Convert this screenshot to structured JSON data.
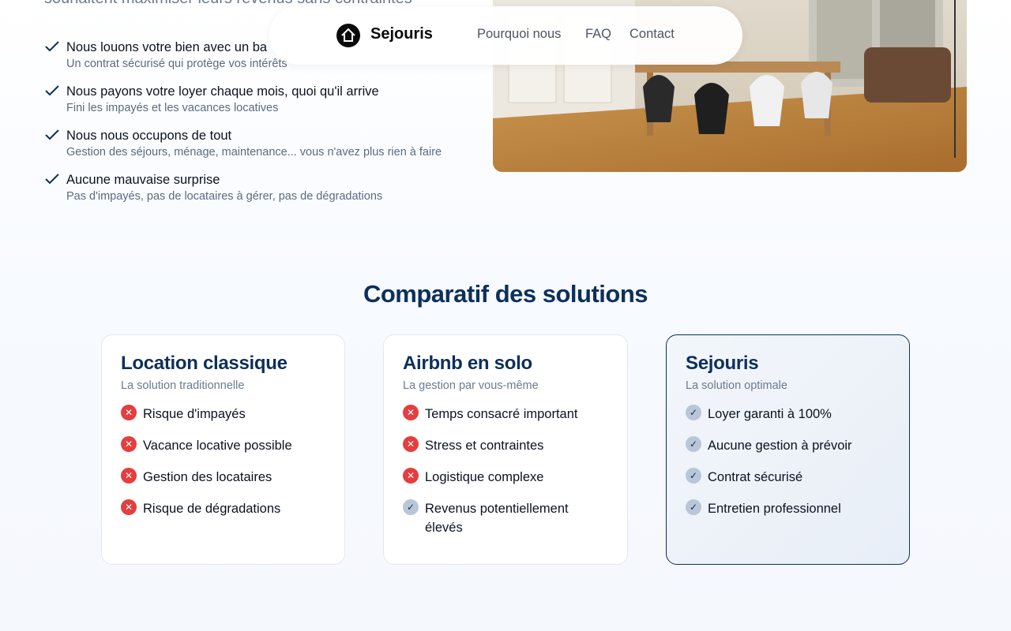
{
  "hero": {
    "subtitle": "souhaitent maximiser leurs revenus sans contraintes",
    "benefits": [
      {
        "title": "Nous louons votre bien avec un ba",
        "desc": "Un contrat sécurisé qui protège vos intérêts"
      },
      {
        "title": "Nous payons votre loyer chaque mois, quoi qu'il arrive",
        "desc": "Fini les impayés et les vacances locatives"
      },
      {
        "title": "Nous nous occupons de tout",
        "desc": "Gestion des séjours, ménage, maintenance... vous n'avez plus rien à faire"
      },
      {
        "title": "Aucune mauvaise surprise",
        "desc": "Pas d'impayés, pas de locataires à gérer, pas de dégradations"
      }
    ]
  },
  "nav": {
    "brand": "Sejouris",
    "links": [
      "Pourquoi nous",
      "FAQ",
      "Contact"
    ]
  },
  "comparatif": {
    "title": "Comparatif des solutions",
    "cards": [
      {
        "title": "Location classique",
        "subtitle": "La solution traditionnelle",
        "items": [
          {
            "text": "Risque d'impayés",
            "ok": false
          },
          {
            "text": "Vacance locative possible",
            "ok": false
          },
          {
            "text": "Gestion des locataires",
            "ok": false
          },
          {
            "text": "Risque de dégradations",
            "ok": false
          }
        ]
      },
      {
        "title": "Airbnb en solo",
        "subtitle": "La gestion par vous-même",
        "items": [
          {
            "text": "Temps consacré important",
            "ok": false
          },
          {
            "text": "Stress et contraintes",
            "ok": false
          },
          {
            "text": "Logistique complexe",
            "ok": false
          },
          {
            "text": "Revenus potentiellement élevés",
            "ok": true
          }
        ]
      },
      {
        "title": "Sejouris",
        "subtitle": "La solution optimale",
        "items": [
          {
            "text": "Loyer garanti à 100%",
            "ok": true
          },
          {
            "text": "Aucune gestion à prévoir",
            "ok": true
          },
          {
            "text": "Contrat sécurisé",
            "ok": true
          },
          {
            "text": "Entretien professionnel",
            "ok": true
          }
        ]
      }
    ]
  },
  "icons": {
    "check": "check-icon",
    "cross": "x-circle-icon",
    "logo": "house-logo-icon"
  },
  "colors": {
    "accent": "#0d2f5a",
    "danger": "#e53e3e",
    "muted_check": "#b8c6d8"
  }
}
